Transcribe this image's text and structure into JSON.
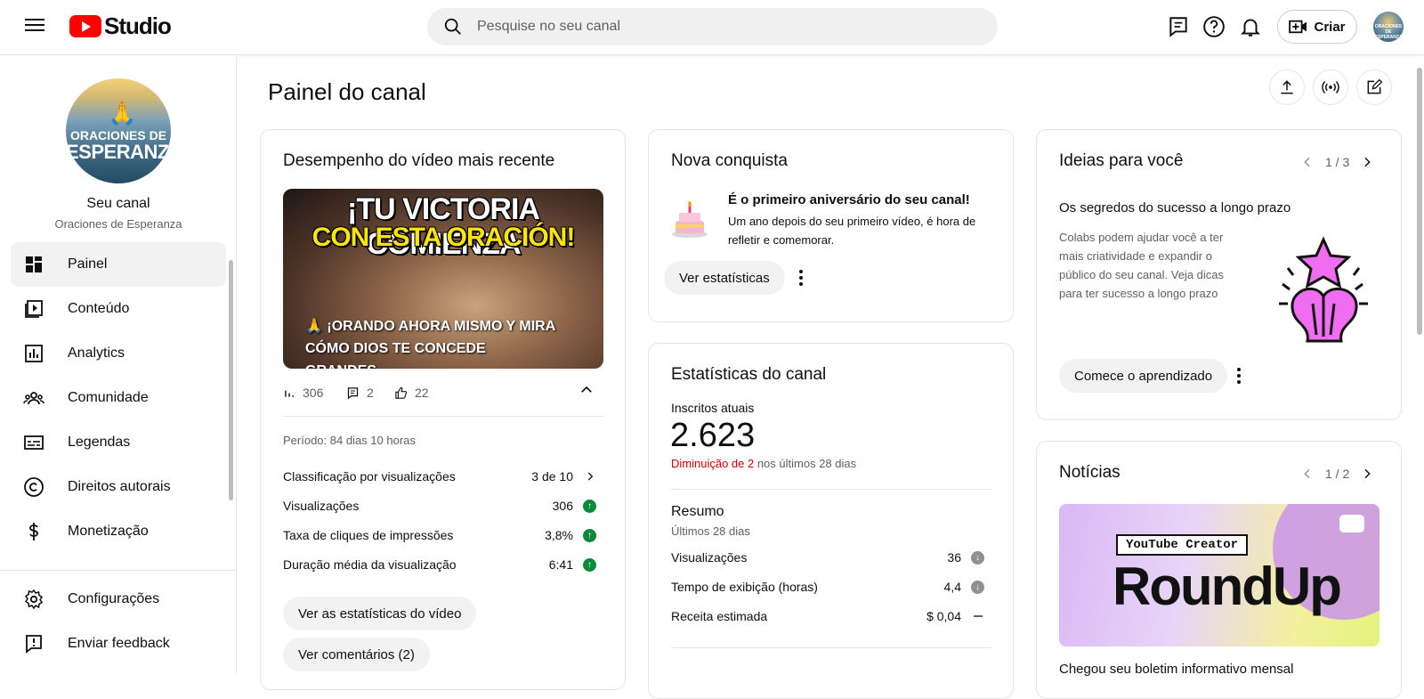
{
  "header": {
    "logo_text": "Studio",
    "search_placeholder": "Pesquise no seu canal",
    "create_label": "Criar",
    "avatar_text": "ORACIONES DE ESPERANZA"
  },
  "sidebar": {
    "channel_avatar_line1": "ORACIONES DE",
    "channel_avatar_line2": "ESPERANZA",
    "channel_title": "Seu canal",
    "channel_name": "Oraciones de Esperanza",
    "items": [
      {
        "label": "Painel",
        "icon": "dashboard-icon"
      },
      {
        "label": "Conteúdo",
        "icon": "content-icon"
      },
      {
        "label": "Analytics",
        "icon": "analytics-icon"
      },
      {
        "label": "Comunidade",
        "icon": "community-icon"
      },
      {
        "label": "Legendas",
        "icon": "subtitles-icon"
      },
      {
        "label": "Direitos autorais",
        "icon": "copyright-icon"
      },
      {
        "label": "Monetização",
        "icon": "dollar-icon"
      }
    ],
    "bottom_items": [
      {
        "label": "Configurações",
        "icon": "gear-icon"
      },
      {
        "label": "Enviar feedback",
        "icon": "feedback-icon"
      }
    ]
  },
  "main": {
    "title": "Painel do canal",
    "latest_video": {
      "title": "Desempenho do vídeo mais recente",
      "thumb_line1": "¡TU VICTORIA COMIENZA",
      "thumb_line2": "CON ESTA ORACIÓN!",
      "thumb_caption": "🙏 ¡ORANDO AHORA MISMO Y MIRA CÓMO DIOS TE CONCEDE GRANDES…",
      "views": "306",
      "comments": "2",
      "likes": "22",
      "period": "Período: 84 dias 10 horas",
      "rows": [
        {
          "label": "Classificação por visualizações",
          "value": "3 de 10"
        },
        {
          "label": "Visualizações",
          "value": "306"
        },
        {
          "label": "Taxa de cliques de impressões",
          "value": "3,8%"
        },
        {
          "label": "Duração média da visualização",
          "value": "6:41"
        }
      ],
      "btn_stats": "Ver as estatísticas do vídeo",
      "btn_comments": "Ver comentários (2)"
    },
    "achievement": {
      "title": "Nova conquista",
      "headline": "É o primeiro aniversário do seu canal!",
      "body": "Um ano depois do seu primeiro vídeo, é hora de refletir e comemorar.",
      "button": "Ver estatísticas"
    },
    "channel_stats": {
      "title": "Estatísticas do canal",
      "subs_label": "Inscritos atuais",
      "subs_value": "2.623",
      "change_red": "Diminuição de 2",
      "change_rest": " nos últimos 28 dias",
      "summary_title": "Resumo",
      "summary_sub": "Últimos 28 dias",
      "rows": [
        {
          "label": "Visualizações",
          "value": "36"
        },
        {
          "label": "Tempo de exibição (horas)",
          "value": "4,4"
        },
        {
          "label": "Receita estimada",
          "value": "$ 0,04"
        }
      ]
    },
    "ideas": {
      "title": "Ideias para você",
      "pager": "1 / 3",
      "headline": "Os segredos do sucesso a longo prazo",
      "body": "Colabs podem ajudar você a ter mais criatividade e expandir o público do seu canal. Veja dicas para ter sucesso a longo prazo",
      "button": "Comece o aprendizado"
    },
    "news": {
      "title": "Notícias",
      "pager": "1 / 2",
      "image_tag": "YouTube Creator",
      "image_title": "RoundUp",
      "teaser": "Chegou seu boletim informativo mensal"
    }
  },
  "colors": {
    "brand_red": "#ff0000",
    "positive": "#0a8a3a",
    "negative_text": "#cc0000"
  }
}
